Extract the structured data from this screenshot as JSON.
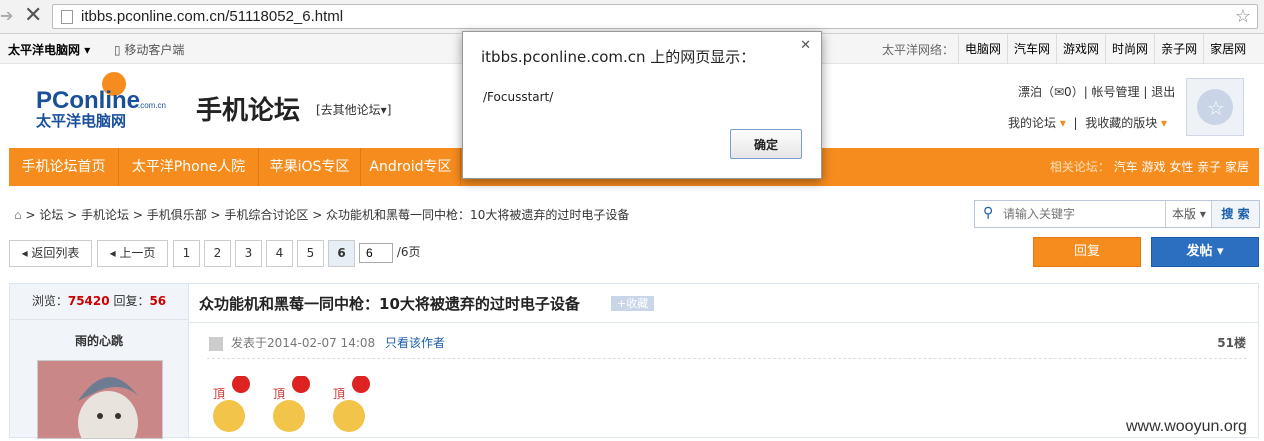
{
  "browser": {
    "url": "itbbs.pconline.com.cn/51118052_6.html"
  },
  "topbar": {
    "site_name": "太平洋电脑网",
    "mobile": "移动客户端",
    "network_label": "太平洋网络：",
    "network_links": [
      "电脑网",
      "汽车网",
      "游戏网",
      "时尚网",
      "亲子网",
      "家居网"
    ]
  },
  "header": {
    "logo_text": "PConline",
    "logo_sub": "太平洋电脑网",
    "logo_domain": ".com.cn",
    "forum_title": "手机论坛",
    "other_forum": "[去其他论坛▾]",
    "user_line1": "漂泊（✉0）| 帐号管理 | 退出",
    "my_forum": "我的论坛",
    "my_fav": "我收藏的版块"
  },
  "nav": {
    "items": [
      "手机论坛首页",
      "太平洋Phone人院",
      "苹果iOS专区",
      "Android专区"
    ],
    "related_label": "相关论坛：",
    "related": "汽车 游戏 女性 亲子 家居"
  },
  "breadcrumb": "> 论坛 > 手机论坛 > 手机俱乐部 > 手机综合讨论区 > 众功能机和黑莓一同中枪：10大将被遗弃的过时电子设备",
  "search": {
    "placeholder": "请输入关键字",
    "scope": "本版",
    "button": "搜 索"
  },
  "pager": {
    "back": "返回列表",
    "prev": "上一页",
    "pages": [
      "1",
      "2",
      "3",
      "4",
      "5",
      "6"
    ],
    "current": "6",
    "input_value": "6",
    "total": "/6页"
  },
  "actions": {
    "reply": "回复",
    "post": "发帖"
  },
  "thread": {
    "views_label": "浏览：",
    "views": "75420",
    "replies_label": "回复：",
    "replies": "56",
    "author": "雨的心跳",
    "title": "众功能机和黑莓一同中枪：10大将被遗弃的过时电子设备",
    "fav": "+收藏",
    "posted": "发表于2014-02-07 14:08",
    "only_author": "只看该作者",
    "floor": "51楼"
  },
  "dialog": {
    "title": "itbbs.pconline.com.cn 上的网页显示：",
    "message": "/Focusstart/",
    "ok": "确定"
  },
  "watermark": "www.wooyun.org"
}
